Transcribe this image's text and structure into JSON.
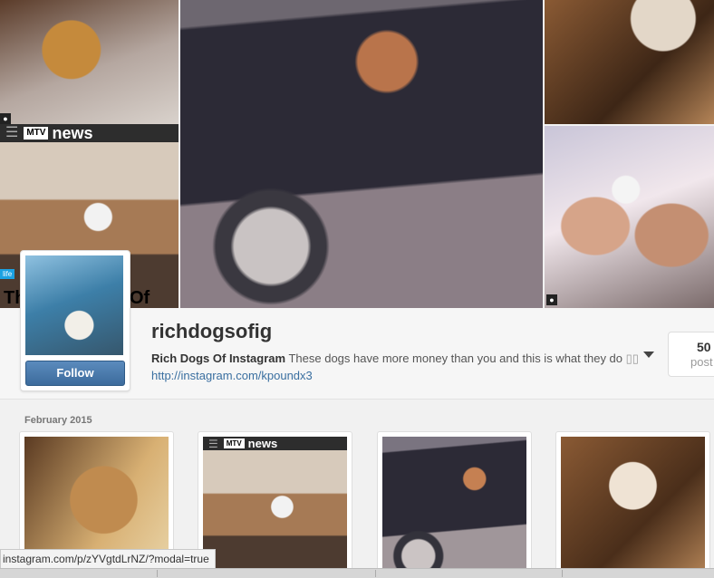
{
  "news_bar": {
    "brand_logo": "MTV",
    "label": "news"
  },
  "left_overlay": {
    "tag": "life",
    "headline_fragment_left": "Th",
    "headline_fragment_right": "Of"
  },
  "profile": {
    "username": "richdogsofig",
    "full_name": "Rich Dogs Of Instagram",
    "bio": "These dogs have more money than you and this is what they do",
    "bio_emoji": "▯▯",
    "website": "http://instagram.com/kpoundx3",
    "follow_label": "Follow",
    "stats": {
      "value": "50",
      "label": "post"
    }
  },
  "feed": {
    "section_date": "February 2015"
  },
  "status_bar": {
    "url": "instagram.com/p/zYVgtdLrNZ/?modal=true"
  },
  "icons": [
    "user-icon",
    "menu-icon",
    "caret-down-icon"
  ]
}
